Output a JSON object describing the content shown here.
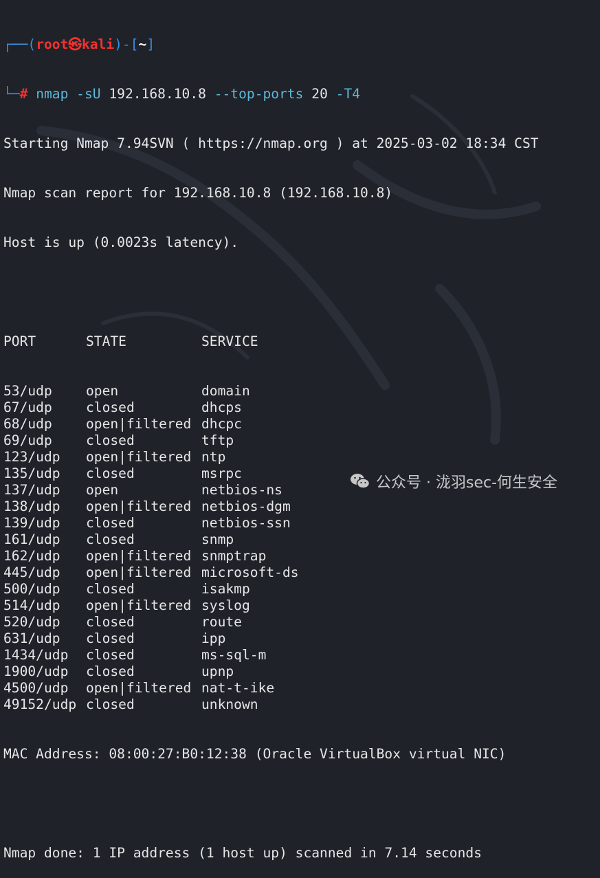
{
  "prompt": {
    "user": "root",
    "skull": "㉿",
    "host": "kali",
    "cwd": "~",
    "symbol": "#"
  },
  "command": {
    "name": "nmap",
    "flag_su": "-sU",
    "target": "192.168.10.8",
    "flag_top": "--top-ports",
    "top_value": "20",
    "flag_t": "-T4"
  },
  "output": {
    "starting": "Starting Nmap 7.94SVN ( https://nmap.org ) at 2025-03-02 18:34 CST",
    "report": "Nmap scan report for 192.168.10.8 (192.168.10.8)",
    "host_up": "Host is up (0.0023s latency).",
    "headers": {
      "port": "PORT",
      "state": "STATE",
      "service": "SERVICE"
    },
    "ports": [
      {
        "port": "53/udp",
        "state": "open",
        "service": "domain"
      },
      {
        "port": "67/udp",
        "state": "closed",
        "service": "dhcps"
      },
      {
        "port": "68/udp",
        "state": "open|filtered",
        "service": "dhcpc"
      },
      {
        "port": "69/udp",
        "state": "closed",
        "service": "tftp"
      },
      {
        "port": "123/udp",
        "state": "open|filtered",
        "service": "ntp"
      },
      {
        "port": "135/udp",
        "state": "closed",
        "service": "msrpc"
      },
      {
        "port": "137/udp",
        "state": "open",
        "service": "netbios-ns"
      },
      {
        "port": "138/udp",
        "state": "open|filtered",
        "service": "netbios-dgm"
      },
      {
        "port": "139/udp",
        "state": "closed",
        "service": "netbios-ssn"
      },
      {
        "port": "161/udp",
        "state": "closed",
        "service": "snmp"
      },
      {
        "port": "162/udp",
        "state": "open|filtered",
        "service": "snmptrap"
      },
      {
        "port": "445/udp",
        "state": "open|filtered",
        "service": "microsoft-ds"
      },
      {
        "port": "500/udp",
        "state": "closed",
        "service": "isakmp"
      },
      {
        "port": "514/udp",
        "state": "open|filtered",
        "service": "syslog"
      },
      {
        "port": "520/udp",
        "state": "closed",
        "service": "route"
      },
      {
        "port": "631/udp",
        "state": "closed",
        "service": "ipp"
      },
      {
        "port": "1434/udp",
        "state": "closed",
        "service": "ms-sql-m"
      },
      {
        "port": "1900/udp",
        "state": "closed",
        "service": "upnp"
      },
      {
        "port": "4500/udp",
        "state": "open|filtered",
        "service": "nat-t-ike"
      },
      {
        "port": "49152/udp",
        "state": "closed",
        "service": "unknown"
      }
    ],
    "mac": "MAC Address: 08:00:27:B0:12:38 (Oracle VirtualBox virtual NIC)",
    "done": "Nmap done: 1 IP address (1 host up) scanned in 7.14 seconds"
  },
  "watermark": {
    "text": "公众号 · 泷羽sec-何生安全",
    "icon": "wechat-icon"
  },
  "colors": {
    "background": "#1f2229",
    "prompt_frame": "#3d8fe0",
    "prompt_user": "#f0332f",
    "command": "#5eb8d8",
    "text": "#e6e6e6"
  }
}
